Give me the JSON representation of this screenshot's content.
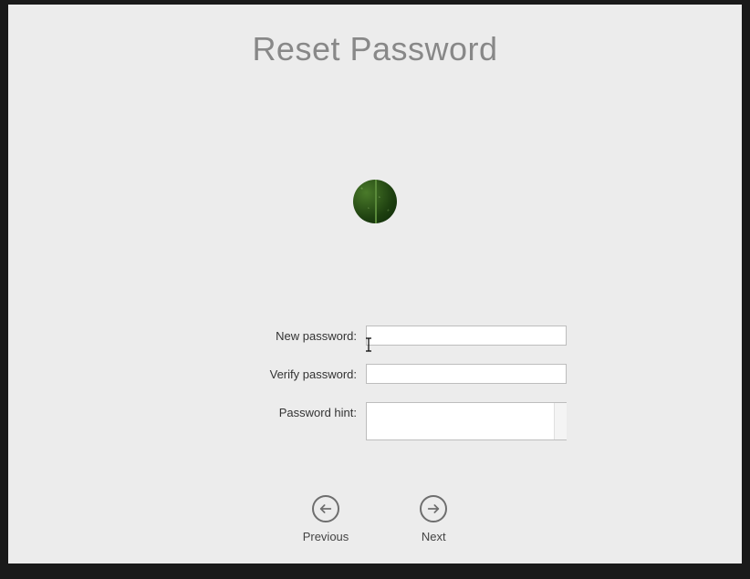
{
  "header": {
    "title": "Reset Password"
  },
  "form": {
    "newPassword": {
      "label": "New password:",
      "value": ""
    },
    "verifyPassword": {
      "label": "Verify password:",
      "value": ""
    },
    "passwordHint": {
      "label": "Password hint:",
      "value": ""
    }
  },
  "nav": {
    "previous": "Previous",
    "next": "Next"
  }
}
